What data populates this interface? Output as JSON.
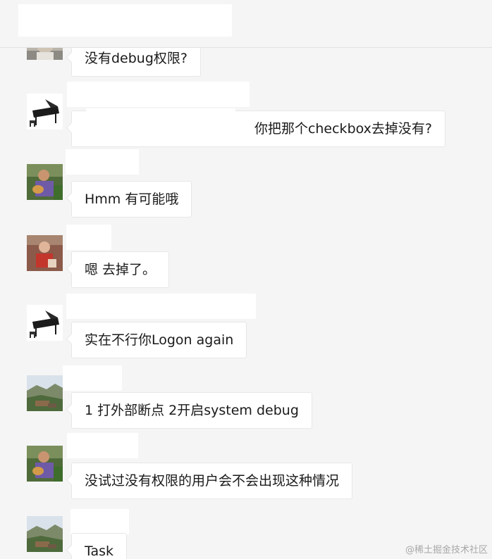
{
  "messages": [
    {
      "text": "没有debug权限?",
      "avatar": "person-avatar-partial"
    },
    {
      "text": "你把那个checkbox去掉没有?",
      "avatar": "piano-avatar"
    },
    {
      "text": "Hmm 有可能哦",
      "avatar": "person-with-cat-avatar"
    },
    {
      "text": "嗯 去掉了。",
      "avatar": "person-red-avatar"
    },
    {
      "text": "实在不行你Logon again",
      "avatar": "piano-avatar"
    },
    {
      "text": "1 打外部断点 2开启system debug",
      "avatar": "landscape-avatar"
    },
    {
      "text": "没试过没有权限的用户会不会出现这种情况",
      "avatar": "person-with-cat-avatar"
    },
    {
      "text": "Task",
      "avatar": "landscape-avatar"
    }
  ],
  "watermark": "@稀土掘金技术社区",
  "colors": {
    "background": "#f5f5f5",
    "bubble": "#ffffff",
    "bubble_border": "#e7e7e7",
    "text": "#1a1a1a"
  }
}
